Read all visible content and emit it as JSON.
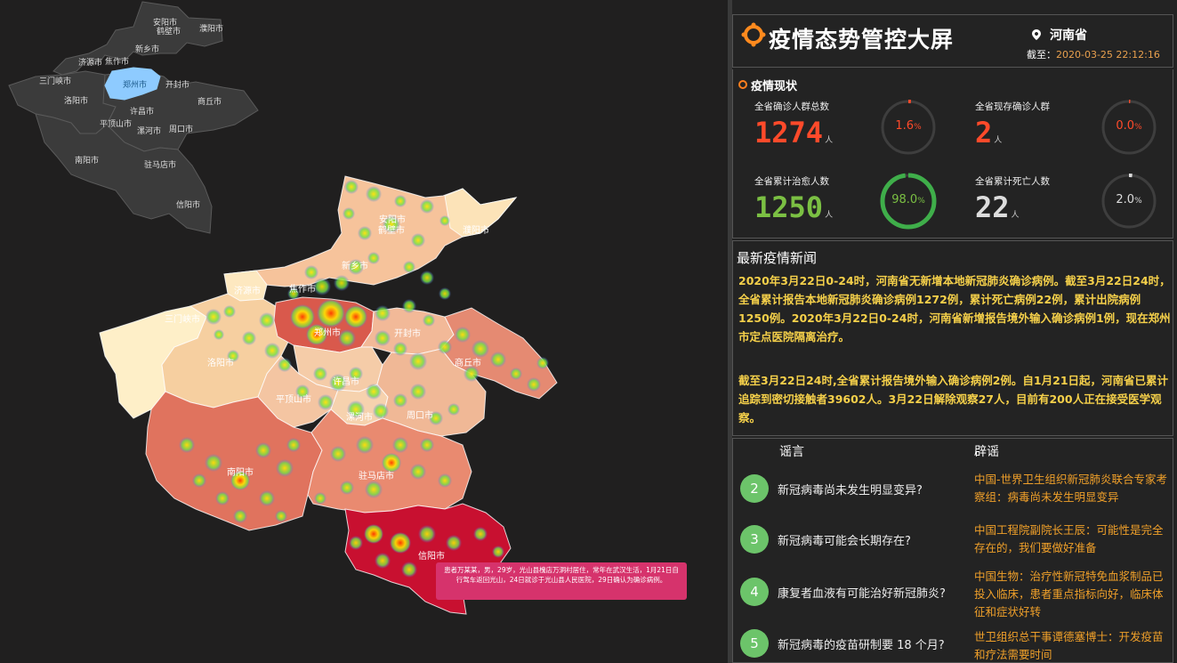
{
  "header": {
    "title": "疫情态势管控大屏",
    "location": "河南省",
    "date_label": "截至：",
    "date_value": "2020-03-25 22:12:16"
  },
  "status": {
    "section_title": "疫情现状",
    "confirmed_total": {
      "label": "全省确诊人群总数",
      "value": "1274",
      "unit": "人",
      "ratio_text": "1.6",
      "ratio_unit": "%",
      "ratio": 0.016,
      "color": "#ff4a2a"
    },
    "current_confirmed": {
      "label": "全省现存确诊人群",
      "value": "2",
      "unit": "人",
      "ratio_text": "0.0",
      "ratio_unit": "%",
      "ratio": 0.0,
      "color": "#ff4a2a"
    },
    "cured_total": {
      "label": "全省累计治愈人数",
      "value": "1250",
      "unit": "人",
      "ratio_text": "98.0",
      "ratio_unit": "%",
      "ratio": 0.98,
      "color": "#7bc043"
    },
    "deaths_total": {
      "label": "全省累计死亡人数",
      "value": "22",
      "unit": "人",
      "ratio_text": "2.0",
      "ratio_unit": "%",
      "ratio": 0.02,
      "color": "#dddddd"
    }
  },
  "news": {
    "title": "最新疫情新闻",
    "paragraphs": [
      "2020年3月22日0-24时，河南省无新增本地新冠肺炎确诊病例。截至3月22日24时，全省累计报告本地新冠肺炎确诊病例1272例，累计死亡病例22例，累计出院病例1250例。2020年3月22日0-24时，河南省新增报告境外输入确诊病例1例，现在郑州市定点医院隔离治疗。",
      "截至3月22日24时,全省累计报告境外输入确诊病例2例。自1月21日起，河南省已累计追踪到密切接触者39602人。3月22日解除观察27人，目前有200人正在接受医学观察。"
    ]
  },
  "rumors": {
    "col_rumor": "谣言",
    "col_debunk": "辟谣",
    "items": [
      {
        "num": "2",
        "q": "新冠病毒尚未发生明显变异?",
        "a": "中国-世界卫生组织新冠肺炎联合专家考察组：病毒尚未发生明显变异"
      },
      {
        "num": "3",
        "q": "新冠病毒可能会长期存在?",
        "a": "中国工程院副院长王辰：可能性是完全存在的，我们要做好准备"
      },
      {
        "num": "4",
        "q": "康复者血液有可能治好新冠肺炎?",
        "a": "中国生物：治疗性新冠特免血浆制品已投入临床，患者重点指标向好，临床体征和症状好转"
      },
      {
        "num": "5",
        "q": "新冠病毒的疫苗研制要 18 个月?",
        "a": "世卫组织总干事谭德塞博士：开发疫苗和疗法需要时间"
      }
    ]
  },
  "mini_map": {
    "cities": [
      "安阳市",
      "鹤壁市",
      "濮阳市",
      "新乡市",
      "焦作市",
      "济源市",
      "三门峡市",
      "郑州市",
      "开封市",
      "洛阳市",
      "许昌市",
      "商丘市",
      "平顶山市",
      "漯河市",
      "周口市",
      "南阳市",
      "驻马店市",
      "信阳市"
    ],
    "highlight_color": "#8ecbff"
  },
  "main_map": {
    "cities": [
      "安阳市",
      "鹤壁市",
      "濮阳市",
      "新乡市",
      "焦作市",
      "济源市",
      "三门峡市",
      "郑州市",
      "开封市",
      "洛阳市",
      "商丘市",
      "许昌市",
      "平顶山市",
      "漯河市",
      "周口市",
      "南阳市",
      "驻马店市",
      "信阳市"
    ]
  },
  "tooltip": {
    "text": "患者万某某，男，29岁，光山县槐店万洞村居住，常年在武汉生活，1月21日自行驾车返回光山，24日就诊于光山县人民医院，29日确认为确诊病例。"
  },
  "icons": {
    "logo": "virus-logo-icon",
    "pin": "location-pin-icon"
  }
}
